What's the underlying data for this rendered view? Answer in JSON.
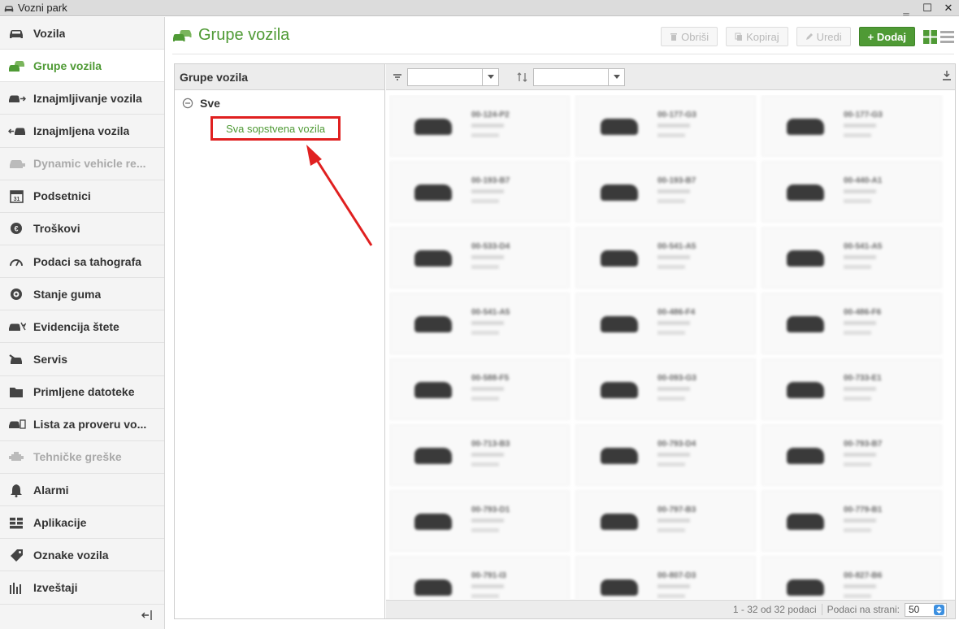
{
  "window": {
    "title": "Vozni park"
  },
  "sidebar": {
    "items": [
      {
        "label": "Vozila",
        "icon": "car-icon",
        "state": "normal"
      },
      {
        "label": "Grupe vozila",
        "icon": "cars-group-icon",
        "state": "active"
      },
      {
        "label": "Iznajmljivanje vozila",
        "icon": "car-out-icon",
        "state": "normal"
      },
      {
        "label": "Iznajmljena vozila",
        "icon": "car-in-icon",
        "state": "normal"
      },
      {
        "label": "Dynamic vehicle re...",
        "icon": "dynamic-car-icon",
        "state": "disabled"
      },
      {
        "label": "Podsetnici",
        "icon": "calendar-icon",
        "state": "normal"
      },
      {
        "label": "Troškovi",
        "icon": "euro-icon",
        "state": "normal"
      },
      {
        "label": "Podaci sa tahografa",
        "icon": "tachograph-icon",
        "state": "normal"
      },
      {
        "label": "Stanje guma",
        "icon": "tire-icon",
        "state": "normal"
      },
      {
        "label": "Evidencija štete",
        "icon": "car-damage-icon",
        "state": "normal"
      },
      {
        "label": "Servis",
        "icon": "service-icon",
        "state": "normal"
      },
      {
        "label": "Primljene datoteke",
        "icon": "folder-icon",
        "state": "normal"
      },
      {
        "label": "Lista za proveru vo...",
        "icon": "checklist-car-icon",
        "state": "normal"
      },
      {
        "label": "Tehničke greške",
        "icon": "engine-icon",
        "state": "disabled"
      },
      {
        "label": "Alarmi",
        "icon": "bell-icon",
        "state": "normal"
      },
      {
        "label": "Aplikacije",
        "icon": "apps-icon",
        "state": "normal"
      },
      {
        "label": "Oznake vozila",
        "icon": "tag-icon",
        "state": "normal"
      },
      {
        "label": "Izveštaji",
        "icon": "reports-icon",
        "state": "normal"
      }
    ],
    "collapse_icon": "collapse-left-icon"
  },
  "header": {
    "title": "Grupe vozila",
    "buttons": {
      "delete": "Obriši",
      "copy": "Kopiraj",
      "edit": "Uredi",
      "add": "+ Dodaj"
    }
  },
  "tree": {
    "header": "Grupe vozila",
    "root": "Sve",
    "child": "Sva sopstvena vozila"
  },
  "grid": {
    "filter_value": "",
    "sort_value": "",
    "tile_labels": [
      "00-124-P2",
      "00-177-G3",
      "00-177-G3",
      "00-193-B7",
      "00-193-B7",
      "00-440-A1",
      "00-533-D4",
      "00-541-A5",
      "00-541-A5",
      "00-541-A5",
      "00-486-F4",
      "00-486-F6",
      "00-588-F5",
      "00-093-G3",
      "00-733-E1",
      "00-713-B3",
      "00-793-D4",
      "00-793-B7",
      "00-793-D1",
      "00-797-B3",
      "00-779-B1",
      "00-791-I3",
      "00-807-D3",
      "00-827-B6"
    ],
    "footer": {
      "range": "1 - 32 od 32 podaci",
      "per_page_label": "Podaci na strani:",
      "per_page_value": "50"
    }
  },
  "colors": {
    "accent": "#4f9a35",
    "annotation": "#e02020"
  }
}
